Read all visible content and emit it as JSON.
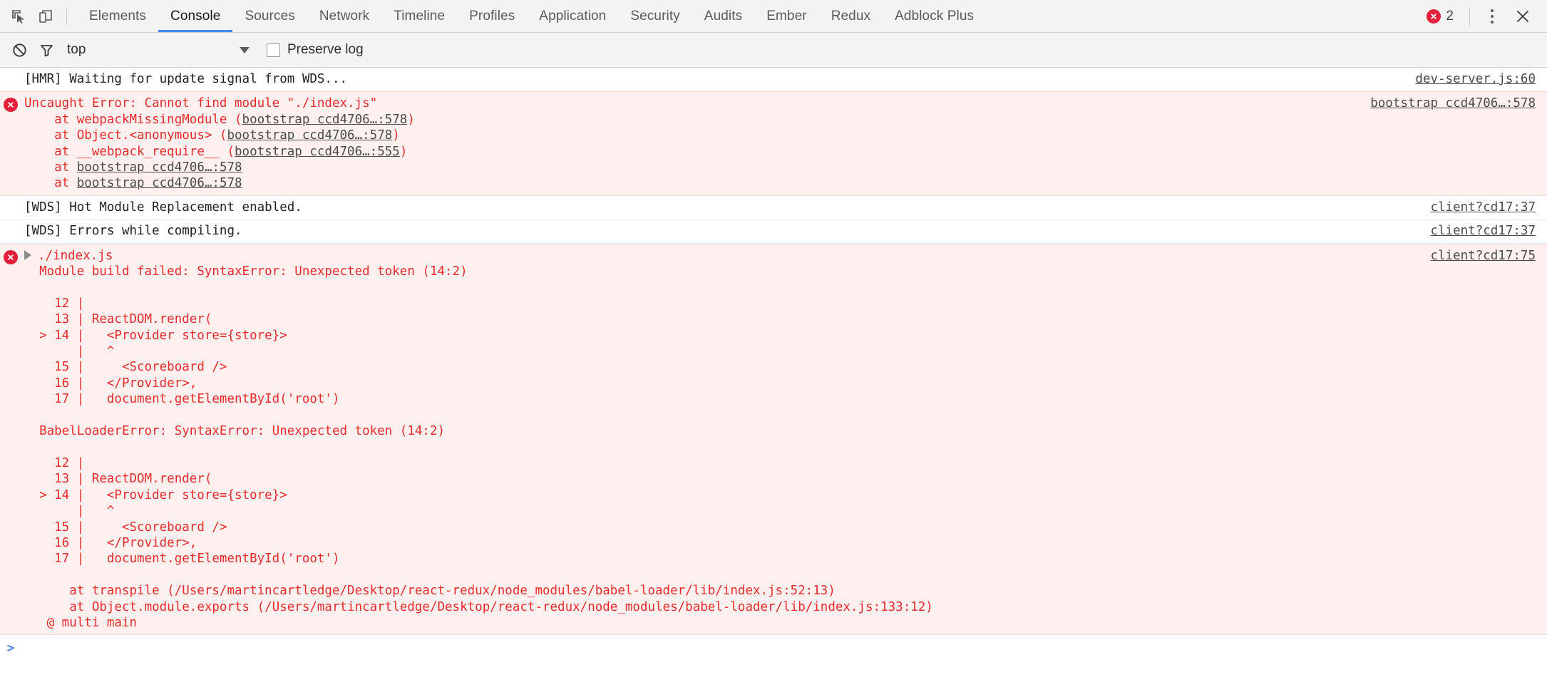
{
  "toolbar": {
    "inspect_icon": "inspect-element-icon",
    "device_icon": "device-toolbar-icon",
    "tabs": [
      {
        "label": "Elements",
        "active": false
      },
      {
        "label": "Console",
        "active": true
      },
      {
        "label": "Sources",
        "active": false
      },
      {
        "label": "Network",
        "active": false
      },
      {
        "label": "Timeline",
        "active": false
      },
      {
        "label": "Profiles",
        "active": false
      },
      {
        "label": "Application",
        "active": false
      },
      {
        "label": "Security",
        "active": false
      },
      {
        "label": "Audits",
        "active": false
      },
      {
        "label": "Ember",
        "active": false
      },
      {
        "label": "Redux",
        "active": false
      },
      {
        "label": "Adblock Plus",
        "active": false
      }
    ],
    "error_count": "2",
    "error_color": "#e2203a",
    "accent_color": "#4285f4",
    "kebab_icon": "more-options-icon",
    "close_icon": "close-icon"
  },
  "filterbar": {
    "clear_icon": "clear-console-icon",
    "filter_icon": "filter-icon",
    "context": "top",
    "caret_icon": "chevron-down-icon",
    "preserve_log_label": "Preserve log",
    "preserve_log_checked": false
  },
  "console": {
    "rows": [
      {
        "type": "log",
        "text": "[HMR] Waiting for update signal from WDS...",
        "source": "dev-server.js:60"
      },
      {
        "type": "error",
        "title": "Uncaught Error: Cannot find module \"./index.js\"",
        "source": "bootstrap ccd4706…:578",
        "stack": [
          {
            "prefix": "    at webpackMissingModule (",
            "link": "bootstrap ccd4706…:578",
            "suffix": ")"
          },
          {
            "prefix": "    at Object.<anonymous> (",
            "link": "bootstrap ccd4706…:578",
            "suffix": ")"
          },
          {
            "prefix": "    at __webpack_require__ (",
            "link": "bootstrap ccd4706…:555",
            "suffix": ")"
          },
          {
            "prefix": "    at ",
            "link": "bootstrap ccd4706…:578",
            "suffix": ""
          },
          {
            "prefix": "    at ",
            "link": "bootstrap ccd4706…:578",
            "suffix": ""
          }
        ]
      },
      {
        "type": "log",
        "text": "[WDS] Hot Module Replacement enabled.",
        "source": "client?cd17:37"
      },
      {
        "type": "log",
        "text": "[WDS] Errors while compiling.",
        "source": "client?cd17:37"
      },
      {
        "type": "error-group",
        "title": "./index.js",
        "source": "client?cd17:75",
        "lines": [
          "  Module build failed: SyntaxError: Unexpected token (14:2)",
          "",
          "    12 |",
          "    13 | ReactDOM.render(",
          "  > 14 |   <Provider store={store}>",
          "       |   ^",
          "    15 |     <Scoreboard />",
          "    16 |   </Provider>,",
          "    17 |   document.getElementById('root')",
          "",
          "  BabelLoaderError: SyntaxError: Unexpected token (14:2)",
          "",
          "    12 |",
          "    13 | ReactDOM.render(",
          "  > 14 |   <Provider store={store}>",
          "       |   ^",
          "    15 |     <Scoreboard />",
          "    16 |   </Provider>,",
          "    17 |   document.getElementById('root')",
          "",
          "      at transpile (/Users/martincartledge/Desktop/react-redux/node_modules/babel-loader/lib/index.js:52:13)",
          "      at Object.module.exports (/Users/martincartledge/Desktop/react-redux/node_modules/babel-loader/lib/index.js:133:12)",
          "   @ multi main"
        ]
      }
    ],
    "prompt_symbol": ">",
    "prompt_value": ""
  }
}
